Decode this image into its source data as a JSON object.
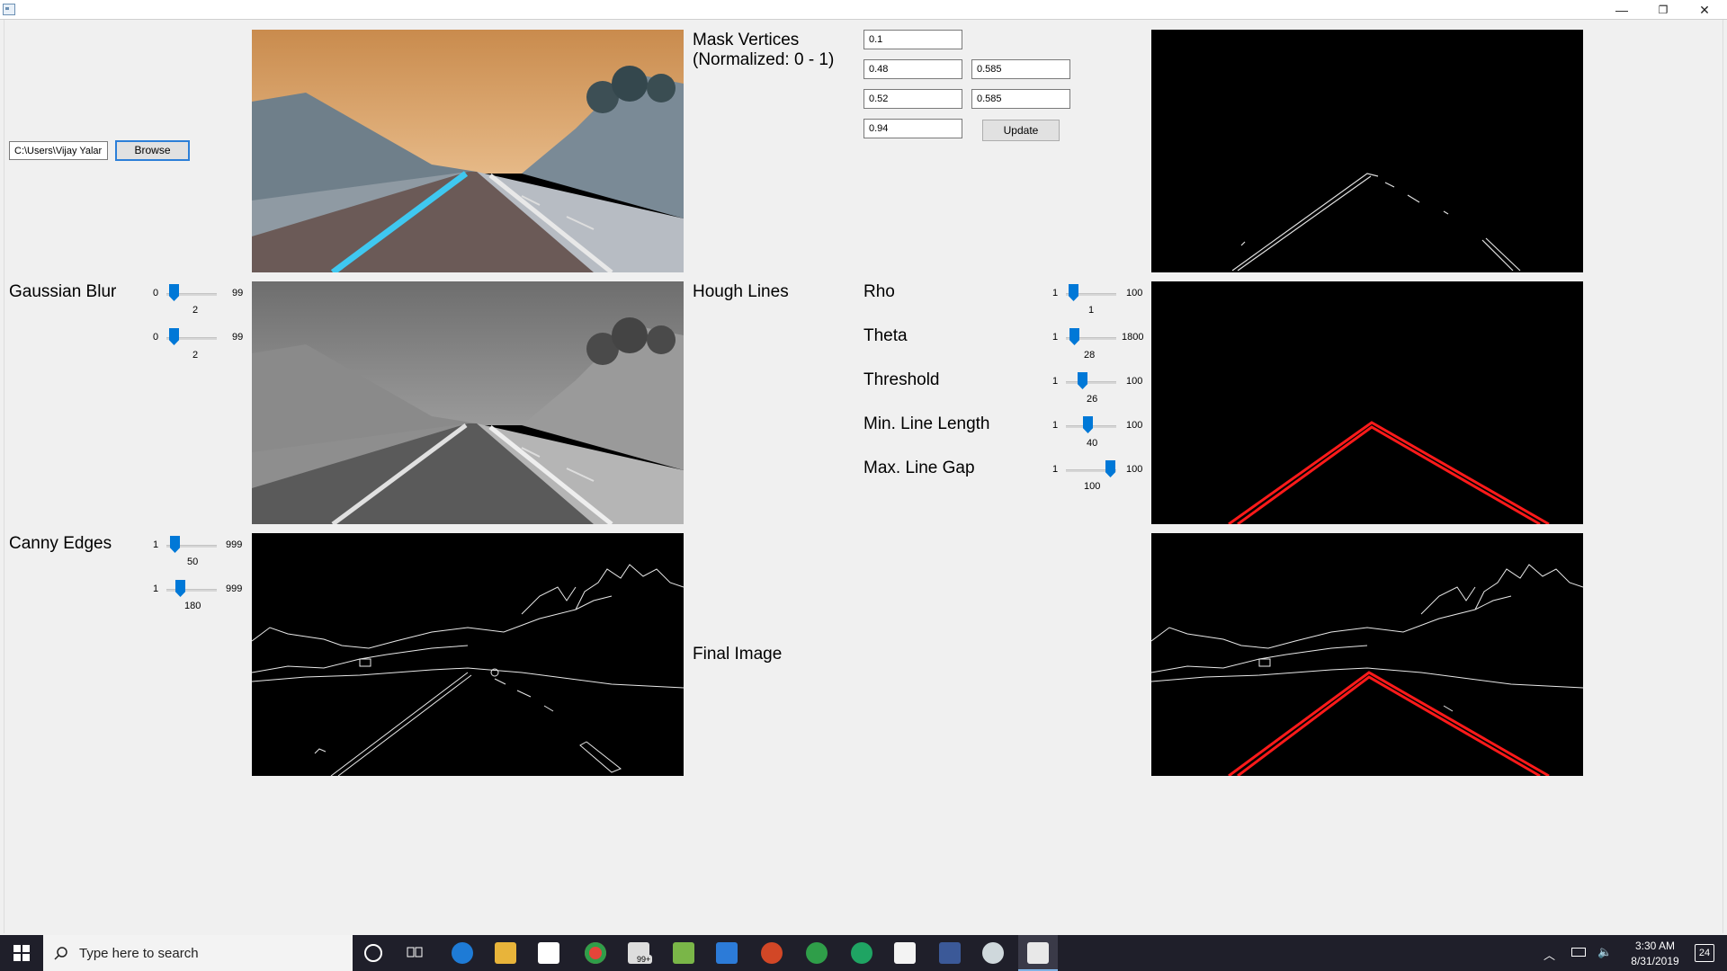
{
  "window": {
    "minimize": "—",
    "restore": "❐",
    "close": "✕"
  },
  "file": {
    "path": "C:\\Users\\Vijay Yalar",
    "browse_label": "Browse"
  },
  "mask": {
    "title_line1": "Mask Vertices",
    "title_line2": "(Normalized: 0 - 1)",
    "v1": "0.1",
    "v2a": "0.48",
    "v2b": "0.585",
    "v3a": "0.52",
    "v3b": "0.585",
    "v4": "0.94",
    "update_label": "Update"
  },
  "gaussian": {
    "label": "Gaussian Blur",
    "k1": {
      "min": "0",
      "max": "99",
      "value": "2",
      "fraction": 0.02
    },
    "k2": {
      "min": "0",
      "max": "99",
      "value": "2",
      "fraction": 0.02
    }
  },
  "canny": {
    "label": "Canny Edges",
    "low": {
      "min": "1",
      "max": "999",
      "value": "50",
      "fraction": 0.05
    },
    "high": {
      "min": "1",
      "max": "999",
      "value": "180",
      "fraction": 0.18
    }
  },
  "hough": {
    "label": "Hough Lines",
    "rho": {
      "label": "Rho",
      "min": "1",
      "max": "100",
      "value": "1"
    },
    "theta": {
      "label": "Theta",
      "min": "1",
      "max": "1800",
      "value": "28"
    },
    "threshold": {
      "label": "Threshold",
      "min": "1",
      "max": "100",
      "value": "26"
    },
    "min_line_length": {
      "label": "Min. Line Length",
      "min": "1",
      "max": "100",
      "value": "40"
    },
    "max_line_gap": {
      "label": "Max. Line Gap",
      "min": "1",
      "max": "100",
      "value": "100"
    }
  },
  "final": {
    "label": "Final Image"
  },
  "taskbar": {
    "search_placeholder": "Type here to search",
    "time": "3:30 AM",
    "date": "8/31/2019",
    "notification_count": "24",
    "mail_badge": "99+"
  },
  "colors": {
    "accent": "#0078d7",
    "lane_red": "#ff1a1a",
    "lane_blue": "#3fc8f0",
    "sky": "#d9a46a"
  }
}
